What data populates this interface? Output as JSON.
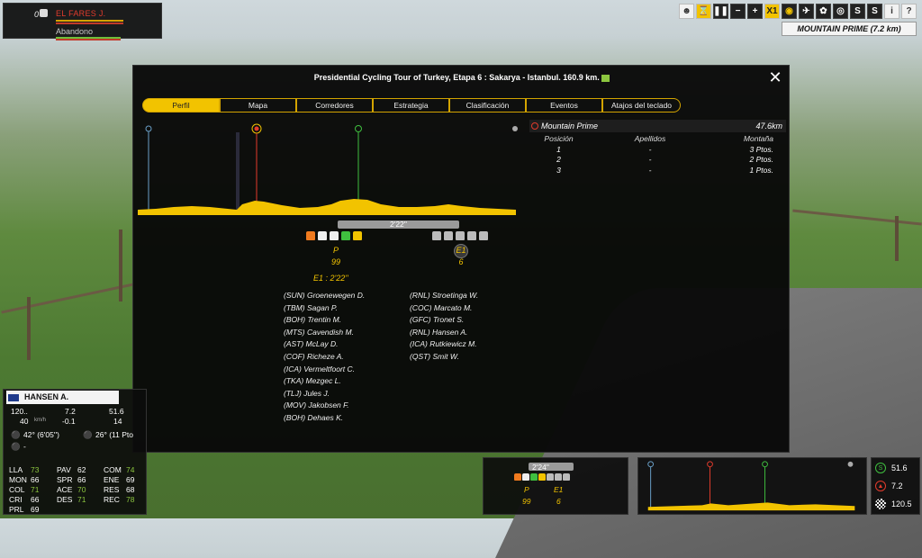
{
  "top_rider": {
    "number": "0",
    "name": "EL FARES J.",
    "status": "Abandono"
  },
  "toolbar": {
    "buttons": [
      "person-icon",
      "hourglass-icon",
      "pause-icon",
      "minus-icon",
      "plus-icon",
      "speed-x1",
      "eye-icon",
      "plane-icon",
      "bird-icon",
      "target-icon",
      "s-icon",
      "s-icon",
      "info-icon",
      "help-icon"
    ],
    "speed_label": "X1",
    "help_label": "?",
    "info_label": "i"
  },
  "mountain_prime_label": "MOUNTAIN PRIME (7.2 km)",
  "modal": {
    "title": "Presidential Cycling Tour of Turkey, Etapa 6 : Sakarya - Istanbul. 160.9 km.",
    "tabs": [
      "Perfil",
      "Mapa",
      "Corredores",
      "Estrategia",
      "Clasificación",
      "Eventos",
      "Atajos del teclado"
    ],
    "active_tab": 0,
    "time_gap": "2'22''",
    "group_p": {
      "label": "P",
      "count": "99"
    },
    "group_e1": {
      "label": "E1",
      "count": "6"
    },
    "e1_time": "E1 : 2'22''",
    "peloton_riders": [
      "(SUN) Groenewegen D.",
      "(TBM) Sagan P.",
      "(BOH) Trentin M.",
      "(MTS) Cavendish M.",
      "(AST) McLay D.",
      "(COF) Richeze A.",
      "(ICA) Vermeltfoort C.",
      "(TKA) Mezgec L.",
      "(TLJ) Jules J.",
      "(MOV) Jakobsen F.",
      "(BOH) Dehaes K."
    ],
    "breakaway_riders": [
      "(RNL) Stroetinga W.",
      "(COC) Marcato M.",
      "(GFC) Tronet S.",
      "(RNL) Hansen A.",
      "(ICA) Rutkiewicz M.",
      "(QST) Smit W."
    ],
    "mountain_prime": {
      "name": "Mountain Prime",
      "distance": "47.6km",
      "columns": [
        "Posición",
        "Apellidos",
        "Montaña"
      ],
      "rows": [
        [
          "1",
          "-",
          "3 Ptos."
        ],
        [
          "2",
          "-",
          "2 Ptos."
        ],
        [
          "3",
          "-",
          "1 Ptos."
        ]
      ]
    }
  },
  "rider_info": {
    "name": "HANSEN A.",
    "speed": "120..",
    "speed_unit_val": "40",
    "speed_unit": "km/h",
    "gap": "7.2",
    "gap_delta": "-0.1",
    "dist": "51.6",
    "dist2": "14",
    "jersey_time": "42° (6'05'')",
    "green_time": "26° (11 Pto",
    "extra": "-",
    "stats": [
      [
        "LLA",
        "73"
      ],
      [
        "MON",
        "66"
      ],
      [
        "COL",
        "71"
      ],
      [
        "CRI",
        "66"
      ],
      [
        "PRL",
        "69"
      ],
      [
        "PAV",
        "62"
      ],
      [
        "SPR",
        "66"
      ],
      [
        "ACE",
        "70"
      ],
      [
        "DES",
        "71"
      ],
      [
        "COM",
        "74"
      ],
      [
        "ENE",
        "69"
      ],
      [
        "RES",
        "68"
      ],
      [
        "REC",
        "78"
      ]
    ]
  },
  "mini_groups": {
    "time_gap": "2'24''",
    "p_label": "P",
    "p_count": "99",
    "e1_label": "E1",
    "e1_count": "6"
  },
  "right_stats": {
    "to_sprint": "51.6",
    "to_climb": "7.2",
    "to_finish": "120.5"
  },
  "colors": {
    "accent": "#f2c300",
    "sprint": "#3fbf3f",
    "climb": "#e23b2c"
  }
}
